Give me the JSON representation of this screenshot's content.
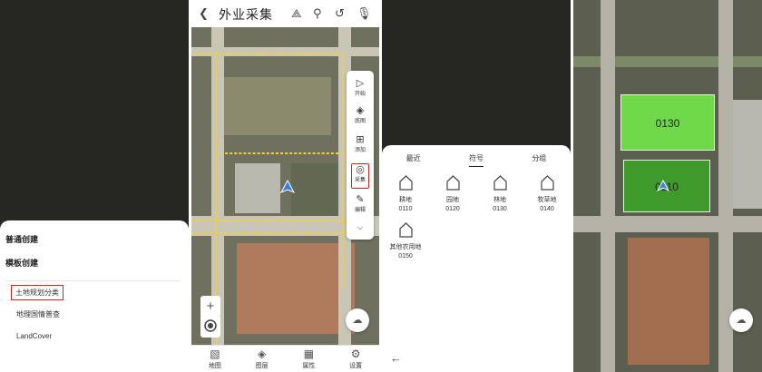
{
  "screen1": {
    "sections": [
      "普通创建",
      "模板创建"
    ],
    "templates": [
      "土地规划分类",
      "地理国情普查",
      "LandCover"
    ]
  },
  "screen2": {
    "title": "外业采集",
    "tools": [
      {
        "label": "开始",
        "icon": "play-icon"
      },
      {
        "label": "底图",
        "icon": "layers-icon"
      },
      {
        "label": "添加",
        "icon": "add-icon"
      },
      {
        "label": "采集",
        "icon": "collect-icon"
      },
      {
        "label": "编辑",
        "icon": "edit-icon"
      }
    ],
    "zoom_in": "+",
    "zoom_out": "−",
    "nav": [
      {
        "label": "地图",
        "icon": "map-icon"
      },
      {
        "label": "图层",
        "icon": "layers-icon"
      },
      {
        "label": "属性",
        "icon": "table-icon"
      },
      {
        "label": "设置",
        "icon": "gear-icon"
      }
    ]
  },
  "screen3": {
    "tabs": [
      "最近",
      "符号",
      "分组"
    ],
    "active_tab": "符号",
    "symbols": [
      {
        "name": "耕地",
        "code": "0110"
      },
      {
        "name": "园地",
        "code": "0120"
      },
      {
        "name": "林地",
        "code": "0130"
      },
      {
        "name": "牧草地",
        "code": "0140"
      },
      {
        "name": "其他农用地",
        "code": "0150"
      }
    ]
  },
  "screen4": {
    "parcels": [
      {
        "code": "0130",
        "color": "#6fd94a"
      },
      {
        "code": "0110",
        "color": "#3f9a2c"
      }
    ]
  },
  "colors": {
    "highlight": "#e02020",
    "accent_blue": "#3b7de0"
  }
}
